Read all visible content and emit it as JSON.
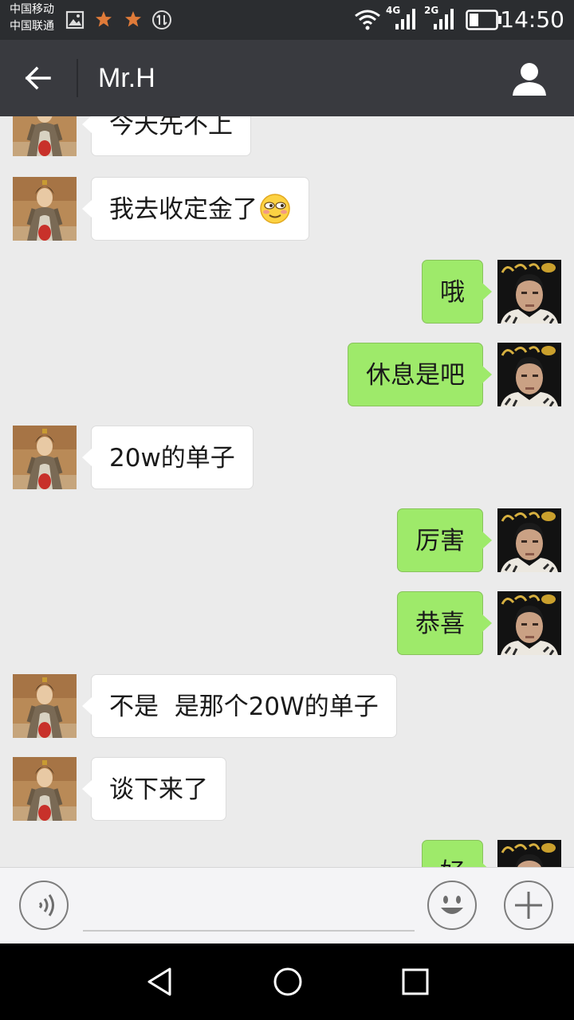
{
  "status_bar": {
    "carrier_1": "中国移动",
    "carrier_2": "中国联通",
    "net_1": "4G",
    "net_2": "2G",
    "time": "14:50",
    "icons": [
      "image-icon",
      "star-icon",
      "star-icon",
      "data-sync-icon",
      "wifi-icon",
      "signal-icon",
      "signal-icon",
      "battery-icon"
    ]
  },
  "header": {
    "title": "Mr.H",
    "back_icon": "arrow-left-icon",
    "profile_icon": "person-icon"
  },
  "messages": [
    {
      "from": "contact",
      "text": "今天先不上"
    },
    {
      "from": "contact",
      "text": "我去收定金了",
      "emoji": "blushing-smile-emoji"
    },
    {
      "from": "me",
      "text": "哦"
    },
    {
      "from": "me",
      "text": "休息是吧"
    },
    {
      "from": "contact",
      "text": "20w的单子"
    },
    {
      "from": "me",
      "text": "厉害"
    },
    {
      "from": "me",
      "text": "恭喜"
    },
    {
      "from": "contact",
      "text": "不是  是那个20W的单子"
    },
    {
      "from": "contact",
      "text": "谈下来了"
    },
    {
      "from": "me",
      "text": "好"
    }
  ],
  "input_bar": {
    "voice_icon": "voice-icon",
    "emoji_icon": "emoji-icon",
    "plus_icon": "plus-icon",
    "text_value": ""
  },
  "nav_bar": [
    "back-triangle-icon",
    "home-circle-icon",
    "recents-square-icon"
  ],
  "colors": {
    "app_bar": "#393a3f",
    "chat_background": "#ebebeb",
    "sent_bubble": "#9eea6a",
    "received_bubble": "#ffffff"
  }
}
